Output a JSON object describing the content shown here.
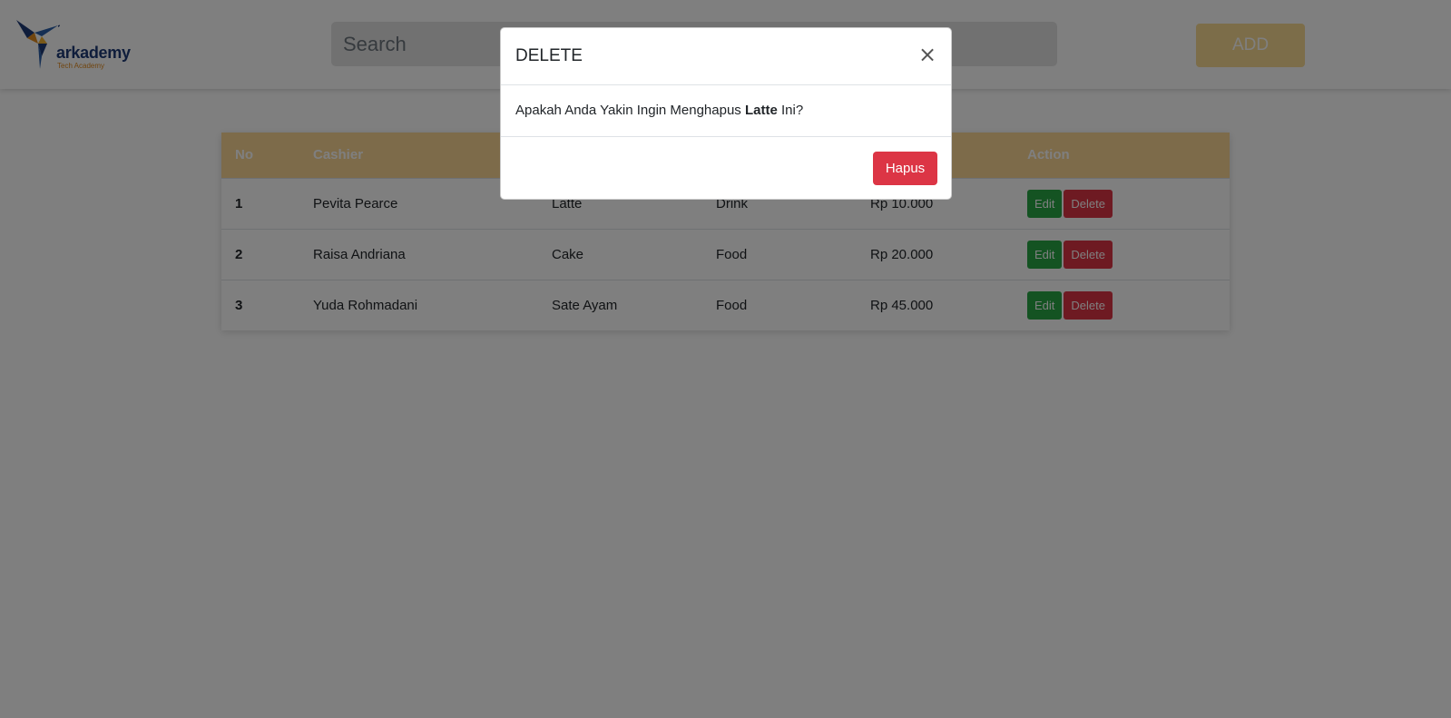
{
  "header": {
    "logo_name": "arkademy",
    "logo_tagline": "Tech Academy",
    "search_placeholder": "Search",
    "add_label": "ADD"
  },
  "table": {
    "headers": [
      "No",
      "Cashier",
      "",
      "",
      "",
      "Action"
    ],
    "rows": [
      {
        "no": "1",
        "cashier": "Pevita Pearce",
        "product": "Latte",
        "category": "Drink",
        "price": "Rp 10.000"
      },
      {
        "no": "2",
        "cashier": "Raisa Andriana",
        "product": "Cake",
        "category": "Food",
        "price": "Rp 20.000"
      },
      {
        "no": "3",
        "cashier": "Yuda Rohmadani",
        "product": "Sate Ayam",
        "category": "Food",
        "price": "Rp 45.000"
      }
    ],
    "edit_label": "Edit",
    "delete_label": "Delete"
  },
  "modal": {
    "title": "DELETE",
    "close_symbol": "×",
    "message_prefix": "Apakah Anda Yakin Ingin Menghapus ",
    "message_item": "Latte",
    "message_suffix": " Ini?",
    "confirm_label": "Hapus"
  },
  "colors": {
    "accent": "#fbd794",
    "edit": "#28a745",
    "delete": "#dc3545"
  }
}
